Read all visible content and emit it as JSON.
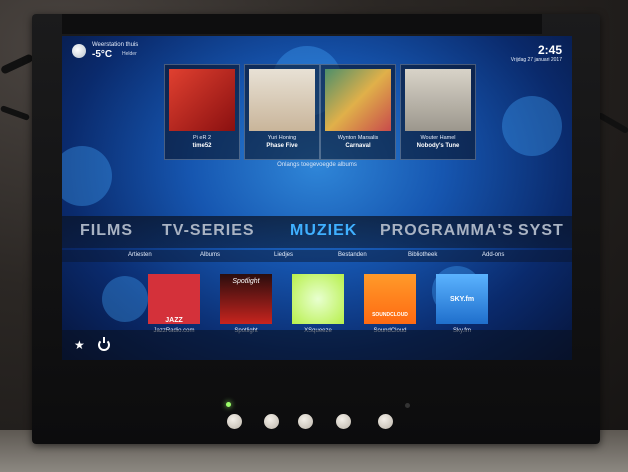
{
  "weather": {
    "station": "Weerstation thuis",
    "temperature": "-5°C",
    "condition": "Helder"
  },
  "clock": {
    "time": "2:45",
    "date": "Vrijdag 27 januari 2017"
  },
  "recent_albums": {
    "caption": "Onlangs toegevoegde albums",
    "items": [
      {
        "artist": "Pi eR 2",
        "title": "time52",
        "color": "#c3202a"
      },
      {
        "artist": "Yuri Honing",
        "title": "Phase Five",
        "color": "#e9e3d8"
      },
      {
        "artist": "Wynton Marsalis",
        "title": "Carnaval",
        "color": "#6c9f7c"
      },
      {
        "artist": "Wouter Hamel",
        "title": "Nobody's Tune",
        "color": "#d4cfc3"
      }
    ]
  },
  "main_menu": {
    "items": [
      "FILMS",
      "TV-SERIES",
      "MUZIEK",
      "PROGRAMMA'S",
      "SYST"
    ],
    "active": "MUZIEK"
  },
  "submenu": {
    "items": [
      "Artiesten",
      "Albums",
      "Liedjes",
      "Bestanden",
      "Bibliotheek",
      "Add-ons"
    ]
  },
  "addons": [
    {
      "label": "JazzRadio.com",
      "thumb_text": "JAZZ",
      "color": "#d4313a"
    },
    {
      "label": "Spotlight",
      "thumb_text": "Spotlight",
      "color": "#c8241e"
    },
    {
      "label": "XSqueeze",
      "thumb_text": "",
      "color": "#b7f04a"
    },
    {
      "label": "SoundCloud",
      "thumb_text": "SOUNDCLOUD",
      "color": "#ff7a1a"
    },
    {
      "label": "Sky.fm",
      "thumb_text": "SKY.fm",
      "color": "#2c8fe0"
    }
  ],
  "icons": {
    "favourites": "star-icon",
    "power": "power-icon",
    "weather": "weather-icon"
  }
}
